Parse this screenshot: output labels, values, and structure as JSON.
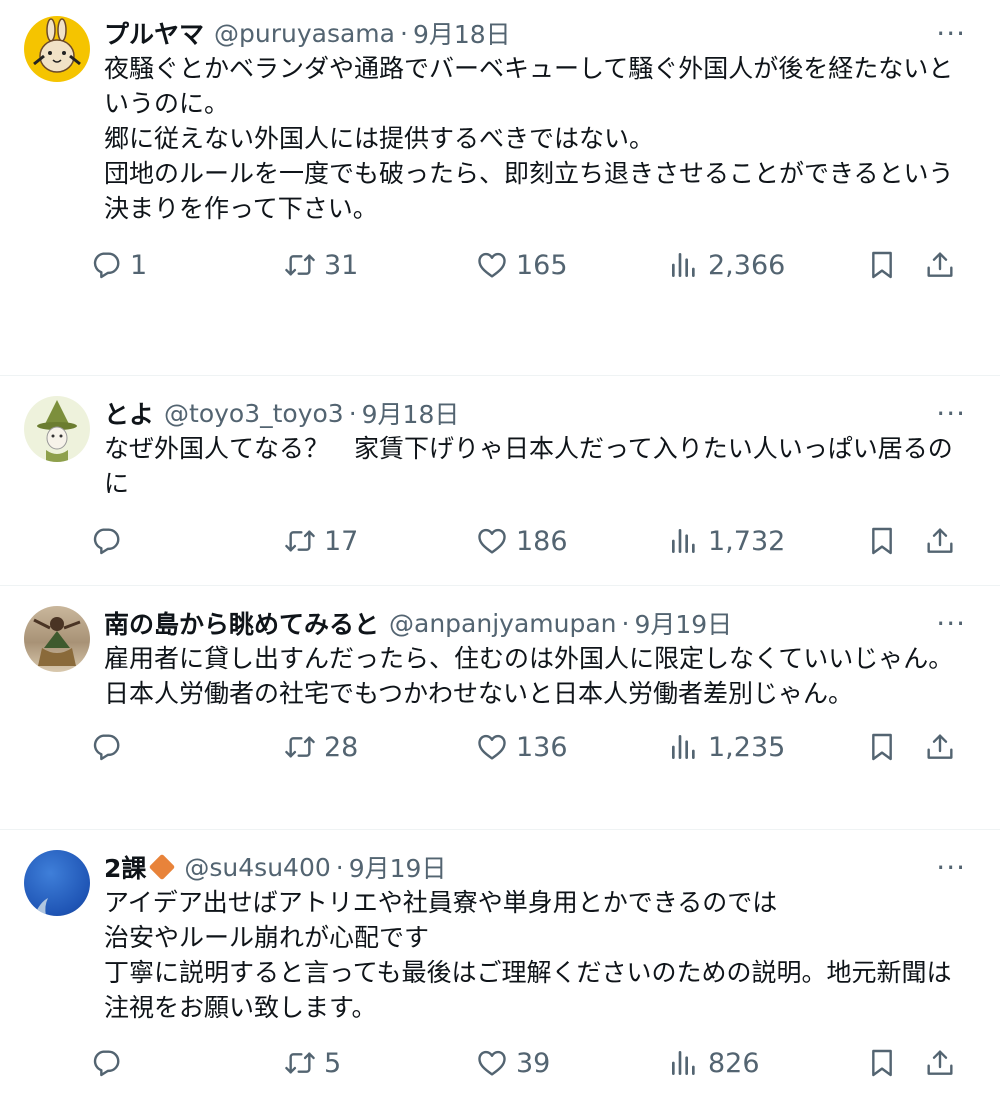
{
  "colors": {
    "muted": "#536471",
    "text": "#0f1419",
    "divider": "#eff3f4",
    "badge": "#e8833a"
  },
  "tweets": [
    {
      "name": "プルヤマ",
      "handle": "@puruyasama",
      "date": "9月18日",
      "more": "···",
      "avatar_icon": "rabbit-character-avatar",
      "text": [
        "夜騒ぐとかベランダや通路でバーベキューして騒ぐ外国人が後を経たないというのに。",
        "",
        "郷に従えない外国人には提供するべきではない。",
        "",
        "団地のルールを一度でも破ったら、即刻立ち退きさせることができるという決まりを作って下さい。"
      ],
      "replies": "1",
      "retweets": "31",
      "likes": "165",
      "views": "2,366"
    },
    {
      "name": "とよ",
      "handle": "@toyo3_toyo3",
      "date": "9月18日",
      "more": "···",
      "avatar_icon": "snufkin-character-avatar",
      "text": [
        "なぜ外国人てなる？　家賃下げりゃ日本人だって入りたい人いっぱい居るのに"
      ],
      "replies": "",
      "retweets": "17",
      "likes": "186",
      "views": "1,732"
    },
    {
      "name": "南の島から眺めてみると",
      "handle": "@anpanjyamupan",
      "date": "9月19日",
      "more": "···",
      "avatar_icon": "beach-dancer-avatar",
      "text": [
        "雇用者に貸し出すんだったら、住むのは外国人に限定しなくていいじゃん。",
        "日本人労働者の社宅でもつかわせないと日本人労働者差別じゃん。"
      ],
      "replies": "",
      "retweets": "28",
      "likes": "136",
      "views": "1,235"
    },
    {
      "name": "2課",
      "handle": "@su4su400",
      "date": "9月19日",
      "more": "···",
      "avatar_icon": "blue-sea-avatar",
      "badge_icon": "orange-diamond-icon",
      "text": [
        "アイデア出せばアトリエや社員寮や単身用とかできるのでは",
        "治安やルール崩れが心配です",
        "丁寧に説明すると言っても最後はご理解くださいのための説明。地元新聞は注視をお願い致します。"
      ],
      "replies": "",
      "retweets": "5",
      "likes": "39",
      "views": "826"
    }
  ]
}
